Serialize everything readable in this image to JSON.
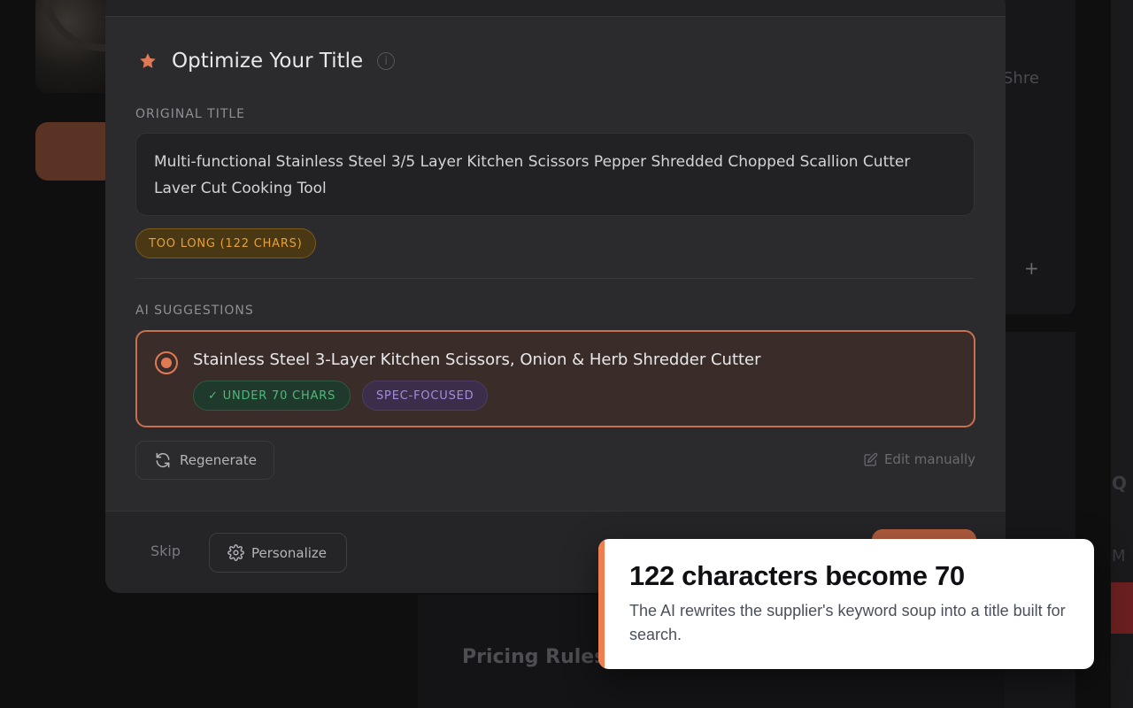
{
  "background": {
    "side_text": "Shre",
    "plus": "+",
    "right_edge_text_1": "Q",
    "right_edge_text_2": "M",
    "pricing_rules_label": "Pricing Rules"
  },
  "modal": {
    "title": "Optimize Your Title",
    "info": "i",
    "original": {
      "label": "ORIGINAL TITLE",
      "text": "Multi-functional Stainless Steel 3/5 Layer Kitchen Scissors Pepper Shredded Chopped Scallion Cutter Laver Cut Cooking Tool",
      "badge": "TOO LONG (122 CHARS)"
    },
    "suggestions": {
      "label": "AI SUGGESTIONS",
      "items": [
        {
          "text": "Stainless Steel 3-Layer Kitchen Scissors, Onion & Herb Shredder Cutter",
          "tags": [
            "✓ UNDER 70 CHARS",
            "SPEC-FOCUSED"
          ],
          "selected": true
        }
      ]
    },
    "regenerate_label": "Regenerate",
    "edit_label": "Edit manually",
    "footer": {
      "skip_label": "Skip",
      "personalize_label": "Personalize"
    }
  },
  "callout": {
    "title": "122 characters become 70",
    "body": "The AI rewrites the supplier's keyword soup into a title built for search."
  },
  "colors": {
    "accent": "#e07a55",
    "warning": "#e5a13a",
    "success": "#4fba7a",
    "purple": "#a78be0"
  }
}
